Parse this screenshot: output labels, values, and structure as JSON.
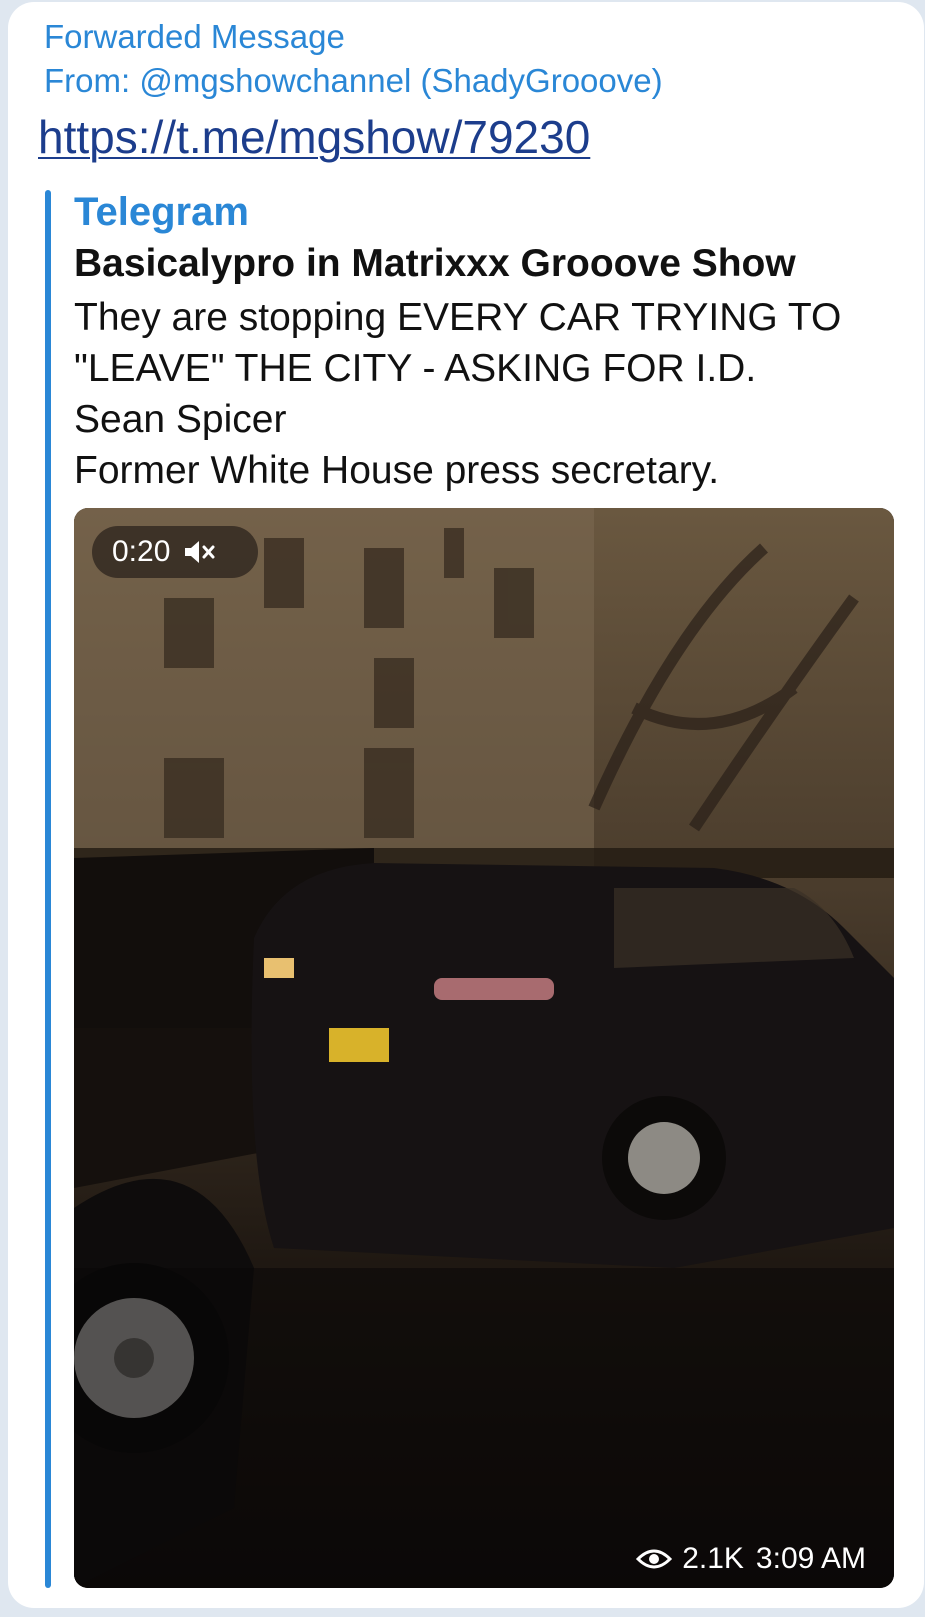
{
  "forward": {
    "title": "Forwarded Message",
    "from": "From: @mgshowchannel (ShadyGrooove)"
  },
  "message": {
    "link": "https://t.me/mgshow/79230"
  },
  "preview": {
    "site_name": "Telegram",
    "title": "Basicalypro in Matrixxx Grooove Show",
    "description_lines": [
      "They are stopping EVERY CAR TRYING TO",
      "\"LEAVE\" THE CITY - ASKING FOR I.D.",
      "Sean Spicer",
      "Former White House press secretary."
    ]
  },
  "video": {
    "duration": "0:20",
    "mute_icon": "speaker-muted-icon",
    "views": "2.1K",
    "time": "3:09 AM",
    "views_icon": "eye-icon"
  },
  "colors": {
    "accent": "#2a87d6",
    "link": "#1c3d8c",
    "background": "#dfe7f0"
  }
}
